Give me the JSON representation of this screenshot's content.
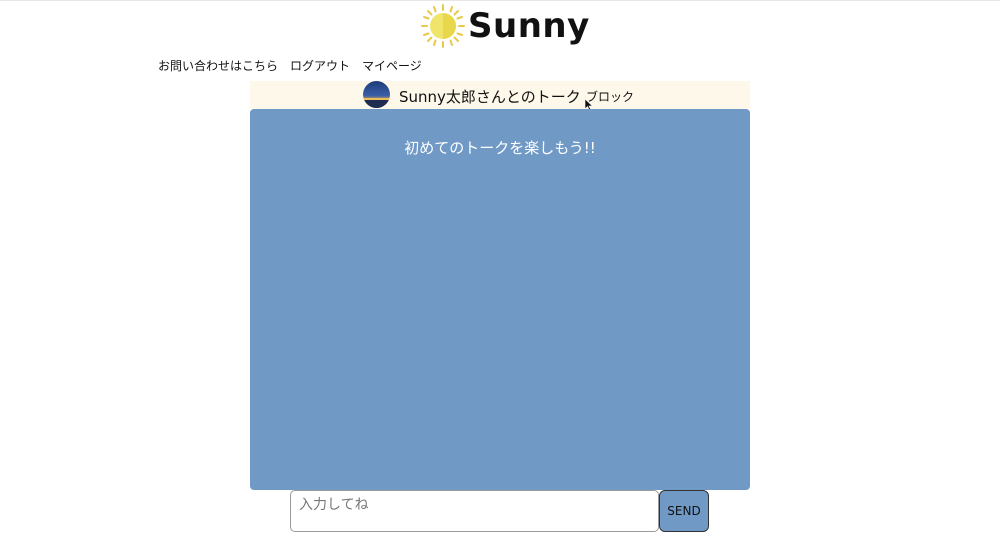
{
  "brand": {
    "name": "Sunny",
    "icon": "sun-icon",
    "text_color": "#111111"
  },
  "nav": {
    "items": [
      {
        "label": "お問い合わせはこちら"
      },
      {
        "label": "ログアウト"
      },
      {
        "label": "マイページ"
      }
    ]
  },
  "talk": {
    "title": "Sunny太郎さんとのトーク",
    "block_label": "ブロック",
    "header_bg": "#fdf8ea",
    "avatar_icon": "avatar-image"
  },
  "chat": {
    "empty_message": "初めてのトークを楽しもう!!",
    "bg_color": "#7099c6"
  },
  "composer": {
    "placeholder": "入力してね",
    "value": "",
    "send_label": "SEND"
  }
}
